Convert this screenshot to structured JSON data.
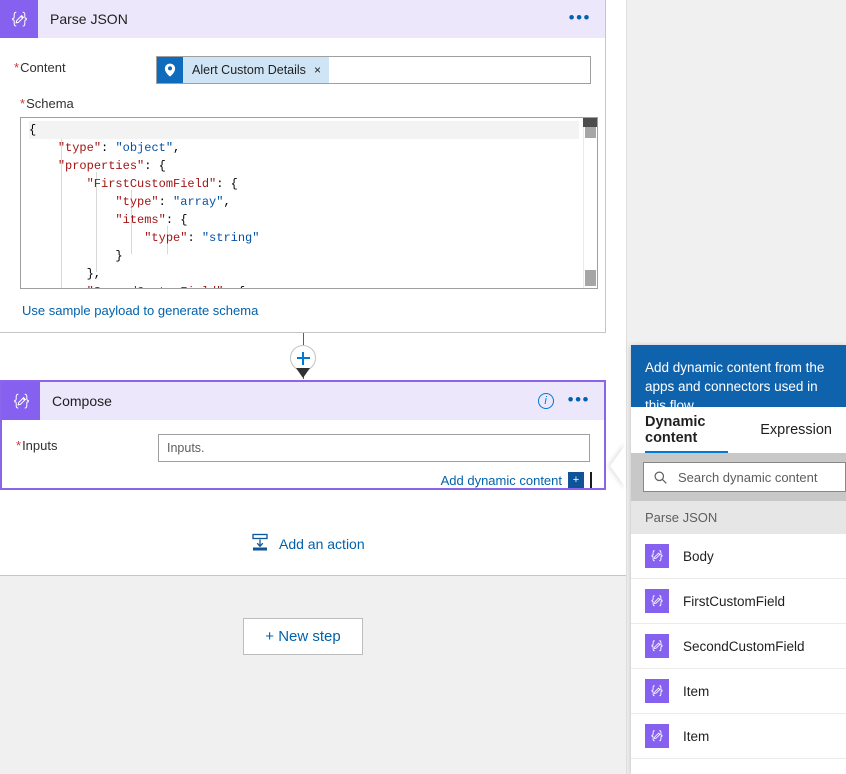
{
  "canvas": {
    "parse_json_card": {
      "icon": "data-operation-braces-pencil-icon",
      "title": "Parse JSON",
      "overflow_label": "•••",
      "content_field": {
        "label": "Content",
        "required_mark": "*",
        "token": {
          "icon": "azure-sentinel-shield-icon",
          "label": "Alert Custom Details",
          "remove_label": "×"
        }
      },
      "schema_field": {
        "label": "Schema",
        "required_mark": "*",
        "code_lines": [
          "{",
          "    \"type\": \"object\",",
          "    \"properties\": {",
          "        \"FirstCustomField\": {",
          "            \"type\": \"array\",",
          "            \"items\": {",
          "                \"type\": \"string\"",
          "            }",
          "        },",
          "        \"SecondCustomField\": {"
        ]
      },
      "sample_payload_link": "Use sample payload to generate schema"
    },
    "connector": {
      "plus_label": "+"
    },
    "compose_card": {
      "icon": "data-operation-braces-pencil-icon",
      "title": "Compose",
      "info_label": "i",
      "overflow_label": "•••",
      "inputs_field": {
        "label": "Inputs",
        "required_mark": "*",
        "placeholder": "Inputs.",
        "value": ""
      },
      "add_dynamic_content_link": "Add dynamic content",
      "add_dynamic_content_plus": "+"
    },
    "add_an_action": {
      "icon": "insert-action-icon",
      "label": "Add an action"
    },
    "new_step_button": "+ New step"
  },
  "flyout": {
    "header_text": "Add dynamic content from the apps and connectors used in this flow.",
    "tabs": [
      {
        "label": "Dynamic content",
        "active": true
      },
      {
        "label": "Expression",
        "active": false
      }
    ],
    "search": {
      "icon": "search-icon",
      "placeholder": "Search dynamic content",
      "value": ""
    },
    "groups": [
      {
        "name": "Parse JSON",
        "items": [
          {
            "icon": "data-operation-braces-pencil-icon",
            "label": "Body"
          },
          {
            "icon": "data-operation-braces-pencil-icon",
            "label": "FirstCustomField"
          },
          {
            "icon": "data-operation-braces-pencil-icon",
            "label": "SecondCustomField"
          },
          {
            "icon": "data-operation-braces-pencil-icon",
            "label": "Item"
          },
          {
            "icon": "data-operation-braces-pencil-icon",
            "label": "Item"
          }
        ]
      }
    ]
  },
  "colors": {
    "accent_purple": "#8661f0",
    "card_header_lavender": "#ece7fb",
    "selected_border": "#8a64eb",
    "link_blue": "#0062ad",
    "flyout_header_blue": "#0f63ac",
    "token_blue": "#0f6cbd",
    "token_bg": "#cfe4f5",
    "required_red": "#d13438"
  }
}
